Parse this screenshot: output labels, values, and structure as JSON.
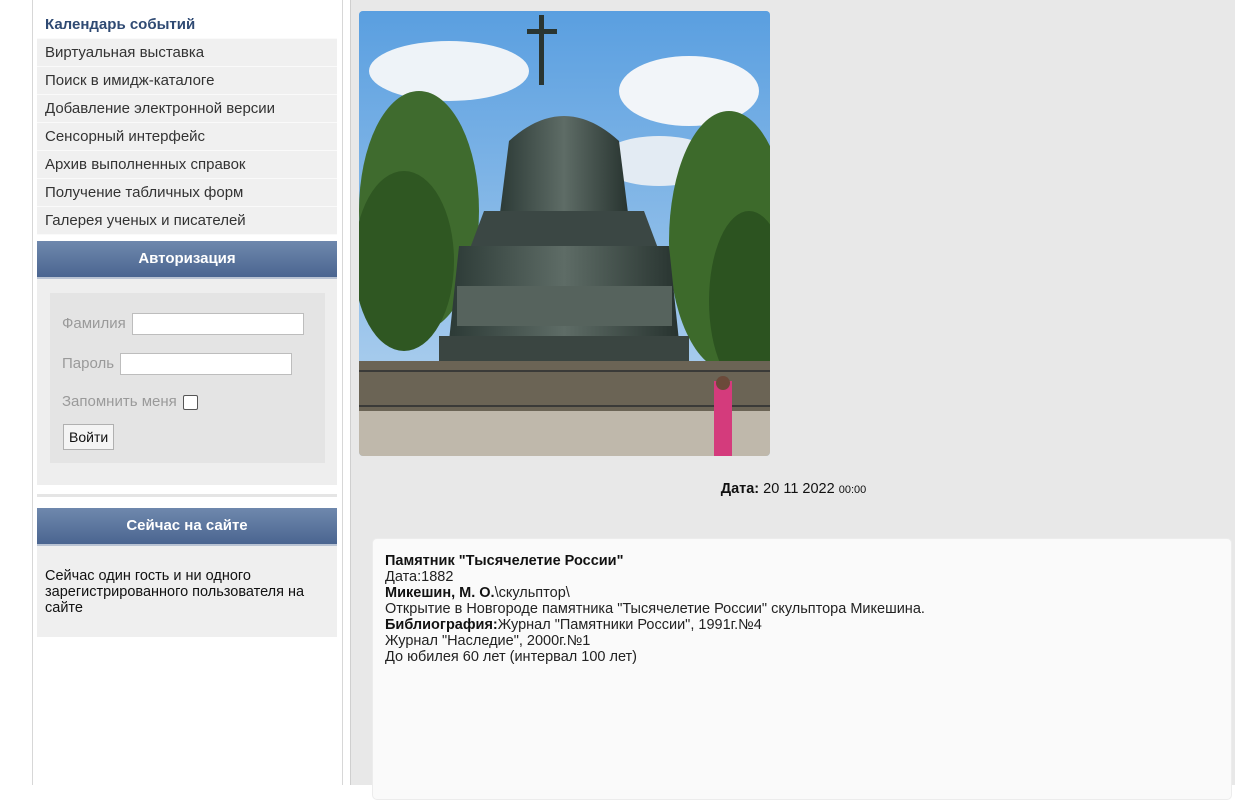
{
  "menu": {
    "items": [
      {
        "label": "Календарь событий",
        "active": true
      },
      {
        "label": "Виртуальная выставка"
      },
      {
        "label": "Поиск в имидж-каталоге"
      },
      {
        "label": "Добавление электронной версии"
      },
      {
        "label": "Сенсорный интерфейс"
      },
      {
        "label": "Архив выполненных справок"
      },
      {
        "label": "Получение табличных форм"
      },
      {
        "label": "Галерея ученых и писателей"
      }
    ]
  },
  "auth": {
    "title": "Авторизация",
    "surname_label": "Фамилия",
    "password_label": "Пароль",
    "remember_label": "Запомнить меня",
    "login_button": "Войти"
  },
  "online": {
    "title": "Сейчас на сайте",
    "text": "Сейчас один гость и ни одного зарегистрированного пользователя на сайте"
  },
  "event": {
    "date_label": "Дата:",
    "date_value": "20 11 2022",
    "time_value": "00:00",
    "title": "Памятник \"Тысячелетие России\"",
    "date_line": "Дата:1882",
    "author_name": "Микешин, М. О.",
    "author_role": "\\скульптор\\",
    "description": "Открытие в Новгороде памятника \"Тысячелетие России\" скульптора Микешина.",
    "bibliography_label": "Библиография:",
    "bibliography_1": "Журнал \"Памятники России\", 1991г.№4",
    "bibliography_2": "Журнал \"Наследие\", 2000г.№1",
    "jubilee": "До юбилея 60 лет (интервал 100 лет)"
  },
  "colors": {
    "header_gradient_top": "#6f88ad",
    "header_gradient_bottom": "#4a6590",
    "active_menu": "#2f4a73"
  }
}
